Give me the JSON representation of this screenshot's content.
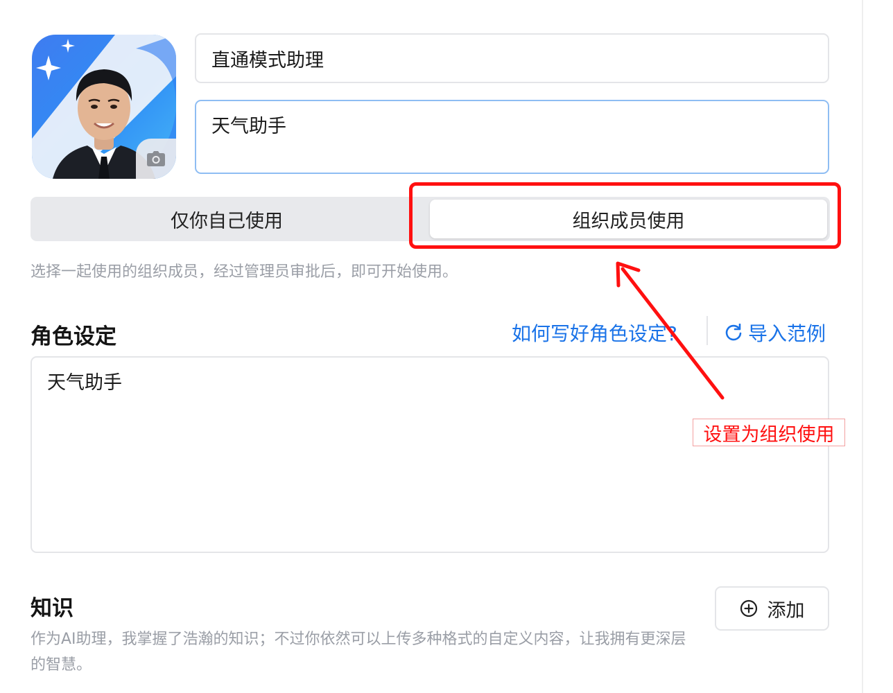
{
  "assistant": {
    "name": "直通模式助理",
    "description": "天气助手"
  },
  "visibility": {
    "options": [
      "仅你自己使用",
      "组织成员使用"
    ],
    "selected": "组织成员使用",
    "hint": "选择一起使用的组织成员，经过管理员审批后，即可开始使用。"
  },
  "role": {
    "title": "角色设定",
    "howto_link": "如何写好角色设定?",
    "import_label": "导入范例",
    "content": "天气助手"
  },
  "annotation": {
    "label": "设置为组织使用",
    "color": "#ff1010"
  },
  "knowledge": {
    "title": "知识",
    "add_label": "添加",
    "description": "作为AI助理，我掌握了浩瀚的知识；不过你依然可以上传多种格式的自定义内容，让我拥有更深层的智慧。"
  },
  "icons": {
    "avatar_upload": "camera-icon",
    "import": "refresh-icon",
    "add": "plus-circle-icon"
  },
  "colors": {
    "link": "#1a73e8",
    "active_input_border": "#8ebdf3",
    "hint_text": "#9a9ea6"
  }
}
